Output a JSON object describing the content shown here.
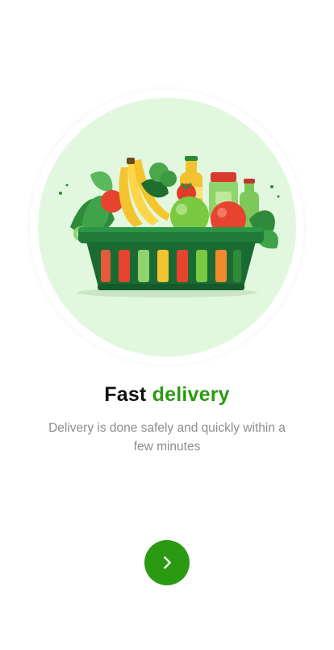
{
  "onboarding": {
    "title_main": "Fast",
    "title_accent": "delivery",
    "subtitle": "Delivery is done safely and quickly within a few minutes",
    "illustration_icon": "grocery-basket-icon",
    "next_icon": "chevron-right-icon"
  },
  "colors": {
    "accent": "#2a9a12",
    "hero_background": "#e1f8df",
    "title": "#111111",
    "subtitle": "#8d8d8d",
    "basket": "#1f7a3a"
  }
}
